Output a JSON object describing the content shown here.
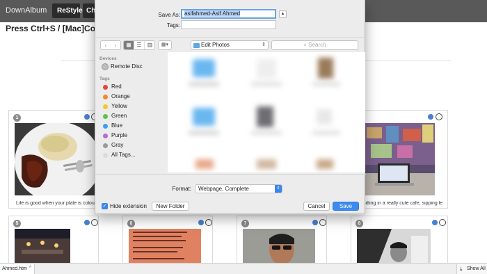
{
  "page": {
    "brand": "DownAlbum",
    "restyle_button": "ReStyle",
    "second_button": "Ch",
    "hint": "Press Ctrl+S / [Mac]Command"
  },
  "cards": [
    {
      "num": "1",
      "caption": "Life is good when your plate is colour"
    },
    {
      "num": "4",
      "caption": "Sitting in a really cute cafe, sipping le"
    },
    {
      "num": "5",
      "caption": ""
    },
    {
      "num": "6",
      "caption": ""
    },
    {
      "num": "7",
      "caption": ""
    },
    {
      "num": "8",
      "caption": ""
    }
  ],
  "downloads": {
    "file_name": "Ahmed.htm",
    "arrow": "^",
    "show_all": "Show All"
  },
  "dialog": {
    "save_as_label": "Save As:",
    "save_as_value": "asifahmed-Asif Ahmed",
    "tags_label": "Tags:",
    "tags_value": "",
    "location": "Edit Photos",
    "search_placeholder": "Search",
    "sidebar": {
      "devices_header": "Devices",
      "remote_disc": "Remote Disc",
      "tags_header": "Tags",
      "tags": [
        {
          "label": "Red",
          "color": "#e5453b"
        },
        {
          "label": "Orange",
          "color": "#f08a2c"
        },
        {
          "label": "Yellow",
          "color": "#f4c530"
        },
        {
          "label": "Green",
          "color": "#5cc248"
        },
        {
          "label": "Blue",
          "color": "#3e9ef2"
        },
        {
          "label": "Purple",
          "color": "#b46cd6"
        },
        {
          "label": "Gray",
          "color": "#9a9a9a"
        },
        {
          "label": "All Tags...",
          "color": "#dcdcdc"
        }
      ]
    },
    "format_label": "Format:",
    "format_value": "Webpage, Complete",
    "hide_extension_label": "Hide extension",
    "new_folder_button": "New Folder",
    "cancel_button": "Cancel",
    "save_button": "Save"
  }
}
